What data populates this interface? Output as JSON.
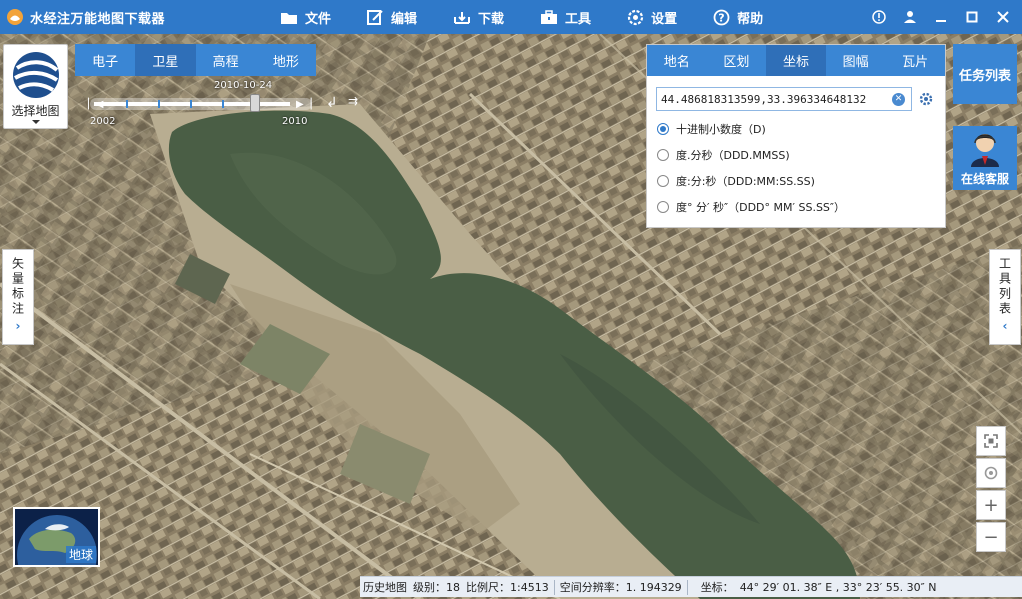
{
  "app": {
    "title": "水经注万能地图下载器"
  },
  "menu": [
    {
      "label": "文件",
      "icon": "folder-icon"
    },
    {
      "label": "编辑",
      "icon": "edit-icon"
    },
    {
      "label": "下载",
      "icon": "download-icon"
    },
    {
      "label": "工具",
      "icon": "toolbox-icon"
    },
    {
      "label": "设置",
      "icon": "settings-icon"
    },
    {
      "label": "帮助",
      "icon": "help-icon"
    }
  ],
  "map_select": {
    "label": "选择地图"
  },
  "layer_tabs": {
    "items": [
      "电子",
      "卫星",
      "高程",
      "地形"
    ],
    "active": "卫星"
  },
  "timeline": {
    "current_date": "2010-10-24",
    "min_year": "2002",
    "max_year": "2010",
    "position": 0.76
  },
  "coord_panel": {
    "tabs": [
      "地名",
      "区划",
      "坐标",
      "图幅",
      "瓦片"
    ],
    "active_tab": "坐标",
    "input_value": "44.486818313599,33.396334648132",
    "options": [
      {
        "label": "十进制小数度（D)",
        "selected": true
      },
      {
        "label": "度.分秒（DDD.MMSS)",
        "selected": false
      },
      {
        "label": "度:分:秒（DDD:MM:SS.SS)",
        "selected": false
      },
      {
        "label": "度° 分′ 秒″（DDD° MM′ SS.SS″）",
        "selected": false
      }
    ]
  },
  "task_list": {
    "label": "任务列表"
  },
  "online_service": {
    "label": "在线客服"
  },
  "left_tab": {
    "label": "矢量标注"
  },
  "right_tab": {
    "label": "工具列表"
  },
  "earth": {
    "label": "地球"
  },
  "status": {
    "history": "历史地图",
    "level": "级别：18",
    "scale": "比例尺：1:4513",
    "resolution": "空间分辨率：1. 194329",
    "coord_label": "坐标：",
    "coord_value": "44° 29′ 01. 38″ E , 33° 23′ 55. 30″ N"
  },
  "colors": {
    "accent": "#2f79c9",
    "tab_blue": "#3a86d4",
    "water": "#4a5e45"
  }
}
